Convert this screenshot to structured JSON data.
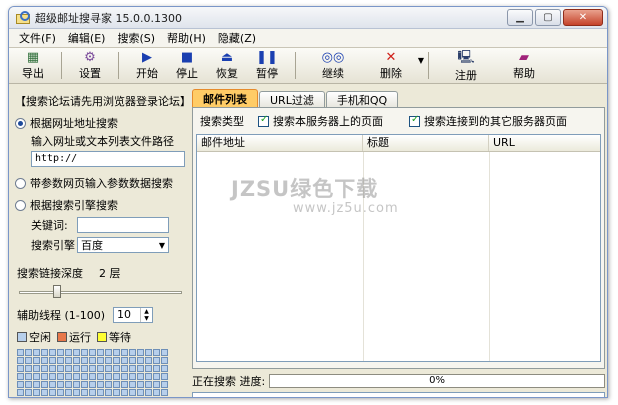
{
  "window": {
    "title": "超级邮址搜寻家 15.0.0.1300"
  },
  "menu": [
    "文件(F)",
    "编辑(E)",
    "搜索(S)",
    "帮助(H)",
    "隐藏(Z)"
  ],
  "toolbar": {
    "export": "导出",
    "settings": "设置",
    "start": "开始",
    "stop": "停止",
    "resume": "恢复",
    "pause": "暂停",
    "continue": "继续",
    "delete": "删除",
    "register": "注册",
    "help": "帮助"
  },
  "left": {
    "title": "【搜索论坛请先用浏览器登录论坛】",
    "opt_url": "根据网址地址搜索",
    "url_hint": "输入网址或文本列表文件路径",
    "url_value": "http://",
    "opt_param": "带参数网页输入参数数据搜索",
    "opt_engine": "根据搜索引擎搜索",
    "keyword_label": "关键词:",
    "keyword_value": "",
    "engine_label": "搜索引擎",
    "engine_value": "百度",
    "depth_label": "搜索链接深度",
    "depth_value": "2 层",
    "depth_level": 0.22,
    "threads_label": "辅助线程 (1-100)",
    "threads_value": "10",
    "legend_idle": "空闲",
    "legend_running": "运行",
    "legend_waiting": "等待",
    "colors": {
      "idle": "#b7cfeb",
      "running": "#e8784a",
      "waiting": "#ffff33"
    }
  },
  "tabs": [
    "邮件列表",
    "URL过滤",
    "手机和QQ"
  ],
  "search": {
    "type_label": "搜索类型",
    "same_server": "搜索本服务器上的页面",
    "other_server": "搜索连接到的其它服务器页面"
  },
  "table": {
    "col_email": "邮件地址",
    "col_title": "标题",
    "col_url": "URL"
  },
  "watermark": {
    "main": "JZSU绿色下载",
    "sub": "www.jz5u.com"
  },
  "status": {
    "label": "正在搜索 进度:",
    "progress_text": "0%",
    "progress": 0
  }
}
